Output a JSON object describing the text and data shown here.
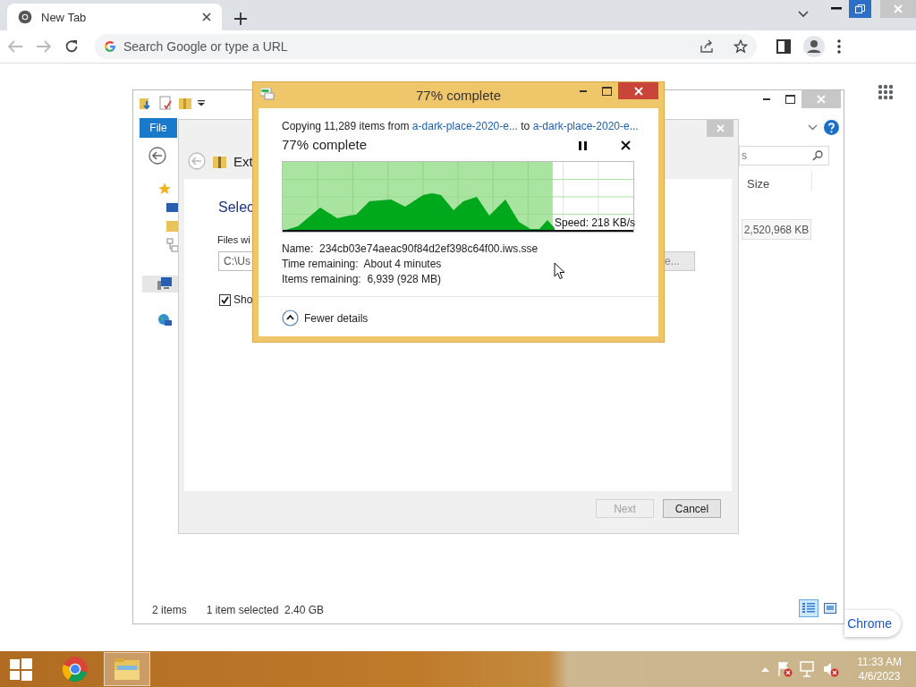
{
  "browser": {
    "tab": {
      "title": "New Tab"
    },
    "omnibox": {
      "placeholder": "Search Google or type a URL"
    },
    "customize_button": {
      "label": "Chrome"
    }
  },
  "explorer": {
    "ribbon_tab": {
      "label": "File",
      "selected": true
    },
    "search_field": {
      "placeholder": "s"
    },
    "column_header": "Size",
    "size_cell": "2,520,968 KB",
    "status_bar": {
      "item_count": "2 items",
      "selection": "1 item selected  2.40 GB"
    }
  },
  "wizard": {
    "title": "Ext",
    "heading": "Selec",
    "files_label": "Files wi",
    "path_field": {
      "value": "C:\\Us"
    },
    "browse_button": "e...",
    "show_checkbox": {
      "label": "Sho",
      "checked": true
    },
    "buttons": [
      {
        "label": "Next",
        "disabled": true
      },
      {
        "label": "Cancel",
        "disabled": false
      }
    ]
  },
  "copy_dialog": {
    "title": "77% complete",
    "summary": {
      "prefix": "Copying 11,289 items from",
      "source": "a-dark-place-2020-e...",
      "middle": "to",
      "destination": "a-dark-place-2020-e..."
    },
    "heading": "77% complete",
    "progress": {
      "level": 0.77
    },
    "speed": "Speed: 218 KB/s",
    "details": [
      {
        "label": "Name:",
        "value": "234cb03e74aeac90f84d2ef398c64f00.iws.sse"
      },
      {
        "label": "Time remaining:",
        "value": "About 4 minutes"
      },
      {
        "label": "Items remaining:",
        "value": "6,939 (928 MB)"
      }
    ],
    "toggle": "Fewer details"
  },
  "taskbar": {
    "apps": [
      {
        "kind": "chrome",
        "selected": false
      },
      {
        "kind": "explorer",
        "selected": true
      }
    ],
    "time": "11:33 AM",
    "date": "4/6/2023"
  }
}
